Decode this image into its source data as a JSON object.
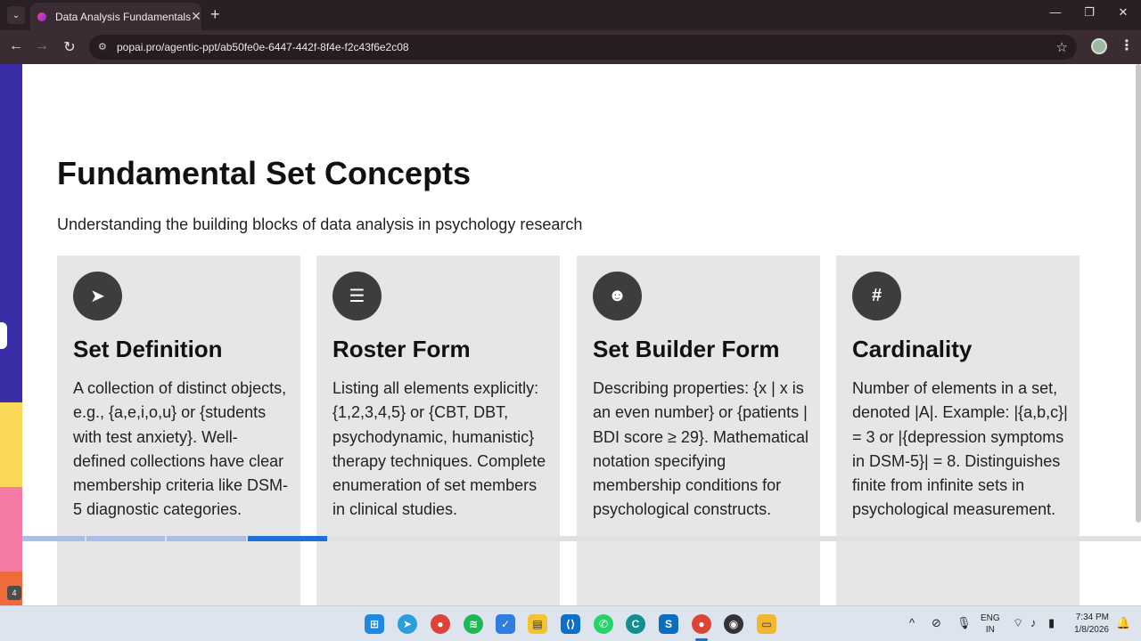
{
  "browser": {
    "tab_title": "Data Analysis Fundamentals",
    "tab_close": "✕",
    "new_tab": "+",
    "url": "popai.pro/agentic-ppt/ab50fe0e-6447-442f-8f4e-f2c43f6e2c08",
    "window_controls": {
      "minimize": "—",
      "maximize": "❐",
      "close": "✕"
    }
  },
  "slide": {
    "title": "Fundamental Set Concepts",
    "subtitle": "Understanding the building blocks of data analysis in psychology research",
    "slide_number": "4",
    "cards": [
      {
        "icon": "paper-plane-icon",
        "icon_glyph": "➤",
        "title": "Set Definition",
        "body": "A collection of distinct objects, e.g., {a,e,i,o,u} or {students with test anxiety}. Well-defined collections have clear membership criteria like DSM-5 diagnostic categories."
      },
      {
        "icon": "checklist-icon",
        "icon_glyph": "☰",
        "title": "Roster Form",
        "body": "Listing all elements explicitly: {1,2,3,4,5} or {CBT, DBT, psychodynamic, humanistic} therapy techniques. Complete enumeration of set members in clinical studies."
      },
      {
        "icon": "smiley-icon",
        "icon_glyph": "☻",
        "title": "Set Builder Form",
        "body": "Describing properties: {x | x is an even number} or {patients | BDI score ≥ 29}. Mathematical notation specifying membership conditions for psychological constructs."
      },
      {
        "icon": "hash-icon",
        "icon_glyph": "#",
        "title": "Cardinality",
        "body": "Number of elements in a set, denoted |A|. Example: |{a,b,c}| = 3 or |{depression symptoms in DSM-5}| = 8. Distinguishes finite from infinite sets in psychological measurement."
      }
    ]
  },
  "taskbar": {
    "language": "ENG",
    "region": "IN",
    "time": "7:34 PM",
    "date": "1/8/2026"
  },
  "colors": {
    "accent_blue": "#1e6fd9",
    "strip_purple": "#3a2ea7",
    "strip_yellow": "#f9d857",
    "strip_pink": "#f47aa3",
    "strip_orange": "#f06b3a"
  }
}
